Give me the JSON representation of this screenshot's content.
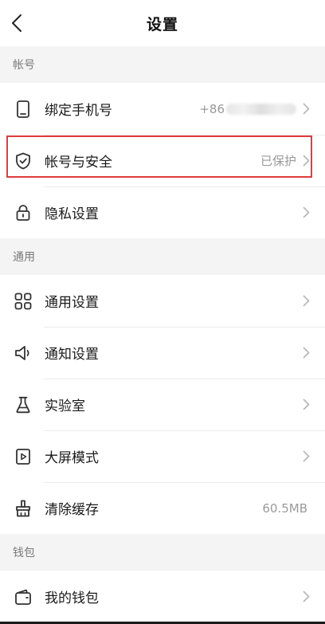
{
  "header": {
    "title": "设置",
    "back_icon": "chevron-left-icon"
  },
  "sections": {
    "account": {
      "header": "帐号",
      "items": [
        {
          "label": "绑定手机号",
          "value_prefix": "+86",
          "icon": "phone-icon"
        },
        {
          "label": "帐号与安全",
          "value": "已保护",
          "icon": "shield-check-icon"
        },
        {
          "label": "隐私设置",
          "value": "",
          "icon": "lock-icon"
        }
      ]
    },
    "general": {
      "header": "通用",
      "items": [
        {
          "label": "通用设置",
          "value": "",
          "icon": "grid-icon"
        },
        {
          "label": "通知设置",
          "value": "",
          "icon": "speaker-icon"
        },
        {
          "label": "实验室",
          "value": "",
          "icon": "flask-icon"
        },
        {
          "label": "大屏模式",
          "value": "",
          "icon": "play-square-icon"
        },
        {
          "label": "清除缓存",
          "value": "60.5MB",
          "icon": "broom-icon"
        }
      ]
    },
    "wallet": {
      "header": "钱包",
      "items": [
        {
          "label": "我的钱包",
          "value": "",
          "icon": "wallet-icon"
        }
      ]
    }
  },
  "colors": {
    "highlight": "#e23b3b",
    "background": "#f4f4f4",
    "row_bg": "#ffffff",
    "muted_text": "#9a9a9a"
  }
}
